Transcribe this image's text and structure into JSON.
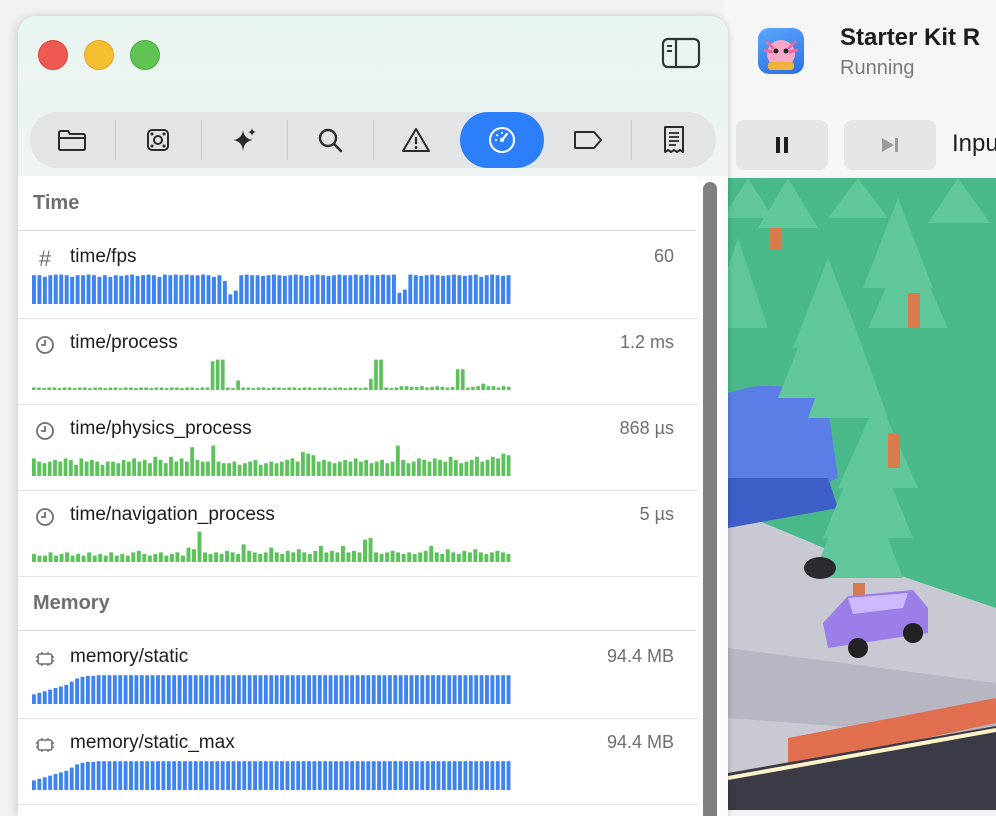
{
  "window": {
    "traffic_lights": [
      "close",
      "minimize",
      "zoom"
    ],
    "toolbar_icons": [
      "folder-icon",
      "scene-icon",
      "sparkles-icon",
      "search-icon",
      "warning-icon",
      "gauge-icon",
      "tag-icon",
      "receipt-icon"
    ],
    "active_tab": "gauge-icon"
  },
  "app": {
    "title": "Starter Kit R",
    "status": "Running",
    "input_label": "Inpu"
  },
  "colors": {
    "accent": "#2d7ff9",
    "bar_blue": "#3d84ef",
    "bar_green": "#5cc35a"
  },
  "sections": [
    {
      "title": "Time",
      "rows": [
        {
          "icon": "hash-icon",
          "icon_glyph": "#",
          "name": "time/fps",
          "value": "60",
          "color": "blue",
          "levels": [
            0.9,
            0.9,
            0.85,
            0.9,
            0.92,
            0.92,
            0.9,
            0.85,
            0.9,
            0.9,
            0.92,
            0.9,
            0.85,
            0.9,
            0.85,
            0.9,
            0.88,
            0.9,
            0.92,
            0.88,
            0.9,
            0.92,
            0.9,
            0.85,
            0.92,
            0.9,
            0.92,
            0.9,
            0.92,
            0.9,
            0.9,
            0.92,
            0.9,
            0.85,
            0.9,
            0.72,
            0.3,
            0.42,
            0.9,
            0.92,
            0.9,
            0.9,
            0.88,
            0.9,
            0.92,
            0.9,
            0.88,
            0.9,
            0.92,
            0.9,
            0.88,
            0.9,
            0.92,
            0.9,
            0.88,
            0.9,
            0.92,
            0.9,
            0.9,
            0.92,
            0.9,
            0.92,
            0.9,
            0.9,
            0.92,
            0.9,
            0.92,
            0.35,
            0.45,
            0.92,
            0.9,
            0.88,
            0.9,
            0.92,
            0.9,
            0.88,
            0.9,
            0.92,
            0.9,
            0.88,
            0.9,
            0.92,
            0.85,
            0.9,
            0.92,
            0.9,
            0.88,
            0.9
          ]
        },
        {
          "icon": "clock-icon",
          "name": "time/process",
          "value": "1.2 ms",
          "color": "green",
          "levels": [
            0.08,
            0.08,
            0.06,
            0.08,
            0.08,
            0.06,
            0.08,
            0.08,
            0.06,
            0.08,
            0.08,
            0.06,
            0.08,
            0.08,
            0.06,
            0.08,
            0.08,
            0.06,
            0.08,
            0.08,
            0.06,
            0.08,
            0.08,
            0.06,
            0.08,
            0.08,
            0.06,
            0.08,
            0.08,
            0.06,
            0.08,
            0.08,
            0.06,
            0.08,
            0.08,
            0.9,
            0.95,
            0.95,
            0.08,
            0.06,
            0.3,
            0.08,
            0.08,
            0.06,
            0.08,
            0.08,
            0.06,
            0.08,
            0.08,
            0.06,
            0.08,
            0.08,
            0.06,
            0.08,
            0.08,
            0.06,
            0.08,
            0.08,
            0.06,
            0.08,
            0.08,
            0.06,
            0.08,
            0.08,
            0.06,
            0.08,
            0.35,
            0.95,
            0.95,
            0.08,
            0.06,
            0.08,
            0.12,
            0.12,
            0.1,
            0.1,
            0.12,
            0.08,
            0.1,
            0.12,
            0.1,
            0.08,
            0.1,
            0.65,
            0.65,
            0.08,
            0.1,
            0.12,
            0.2,
            0.12,
            0.12,
            0.08,
            0.12,
            0.1
          ]
        },
        {
          "icon": "clock-icon",
          "name": "time/physics_process",
          "value": "868 µs",
          "color": "green",
          "levels": [
            0.55,
            0.45,
            0.4,
            0.45,
            0.5,
            0.45,
            0.55,
            0.5,
            0.35,
            0.55,
            0.45,
            0.5,
            0.45,
            0.35,
            0.45,
            0.45,
            0.4,
            0.5,
            0.45,
            0.55,
            0.45,
            0.5,
            0.4,
            0.6,
            0.5,
            0.4,
            0.6,
            0.45,
            0.55,
            0.45,
            0.9,
            0.5,
            0.45,
            0.45,
            0.95,
            0.45,
            0.4,
            0.4,
            0.45,
            0.35,
            0.4,
            0.45,
            0.5,
            0.35,
            0.4,
            0.45,
            0.4,
            0.45,
            0.5,
            0.55,
            0.45,
            0.75,
            0.7,
            0.65,
            0.45,
            0.5,
            0.45,
            0.4,
            0.45,
            0.5,
            0.45,
            0.55,
            0.45,
            0.5,
            0.4,
            0.45,
            0.5,
            0.4,
            0.45,
            0.95,
            0.5,
            0.4,
            0.45,
            0.55,
            0.5,
            0.45,
            0.55,
            0.5,
            0.45,
            0.6,
            0.5,
            0.4,
            0.45,
            0.5,
            0.6,
            0.45,
            0.5,
            0.6,
            0.55,
            0.7,
            0.65
          ]
        },
        {
          "icon": "clock-icon",
          "name": "time/navigation_process",
          "value": "5 µs",
          "color": "green",
          "levels": [
            0.25,
            0.2,
            0.2,
            0.3,
            0.2,
            0.25,
            0.3,
            0.2,
            0.25,
            0.2,
            0.3,
            0.2,
            0.25,
            0.2,
            0.3,
            0.2,
            0.25,
            0.2,
            0.3,
            0.35,
            0.25,
            0.2,
            0.25,
            0.3,
            0.2,
            0.25,
            0.3,
            0.2,
            0.45,
            0.4,
            0.95,
            0.3,
            0.25,
            0.3,
            0.25,
            0.35,
            0.3,
            0.25,
            0.55,
            0.35,
            0.3,
            0.25,
            0.3,
            0.45,
            0.3,
            0.25,
            0.35,
            0.3,
            0.4,
            0.3,
            0.25,
            0.35,
            0.5,
            0.3,
            0.35,
            0.3,
            0.5,
            0.3,
            0.35,
            0.3,
            0.7,
            0.75,
            0.3,
            0.25,
            0.3,
            0.35,
            0.3,
            0.25,
            0.3,
            0.25,
            0.3,
            0.35,
            0.5,
            0.3,
            0.25,
            0.4,
            0.3,
            0.25,
            0.35,
            0.3,
            0.4,
            0.3,
            0.25,
            0.3,
            0.35,
            0.3,
            0.25
          ]
        }
      ]
    },
    {
      "title": "Memory",
      "rows": [
        {
          "icon": "chip-icon",
          "name": "memory/static",
          "value": "94.4 MB",
          "color": "blue",
          "levels": [
            0.3,
            0.35,
            0.4,
            0.45,
            0.5,
            0.55,
            0.6,
            0.7,
            0.8,
            0.85,
            0.88,
            0.88,
            0.9,
            0.9,
            0.9,
            0.9,
            0.9,
            0.9,
            0.9,
            0.9,
            0.9,
            0.9,
            0.9,
            0.9,
            0.9,
            0.9,
            0.9,
            0.9,
            0.9,
            0.9,
            0.9,
            0.9,
            0.9,
            0.9,
            0.9,
            0.9,
            0.9,
            0.9,
            0.9,
            0.9,
            0.9,
            0.9,
            0.9,
            0.9,
            0.9,
            0.9,
            0.9,
            0.9,
            0.9,
            0.9,
            0.9,
            0.9,
            0.9,
            0.9,
            0.9,
            0.9,
            0.9,
            0.9,
            0.9,
            0.9,
            0.9,
            0.9,
            0.9,
            0.9,
            0.9,
            0.9,
            0.9,
            0.9,
            0.9,
            0.9,
            0.9,
            0.9,
            0.9,
            0.9,
            0.9,
            0.9,
            0.9,
            0.9,
            0.9,
            0.9,
            0.9,
            0.9,
            0.9,
            0.9,
            0.9,
            0.9,
            0.9,
            0.9,
            0.9
          ]
        },
        {
          "icon": "chip-icon",
          "name": "memory/static_max",
          "value": "94.4 MB",
          "color": "blue",
          "levels": [
            0.3,
            0.35,
            0.4,
            0.45,
            0.5,
            0.55,
            0.6,
            0.7,
            0.8,
            0.85,
            0.88,
            0.88,
            0.9,
            0.9,
            0.9,
            0.9,
            0.9,
            0.9,
            0.9,
            0.9,
            0.9,
            0.9,
            0.9,
            0.9,
            0.9,
            0.9,
            0.9,
            0.9,
            0.9,
            0.9,
            0.9,
            0.9,
            0.9,
            0.9,
            0.9,
            0.9,
            0.9,
            0.9,
            0.9,
            0.9,
            0.9,
            0.9,
            0.9,
            0.9,
            0.9,
            0.9,
            0.9,
            0.9,
            0.9,
            0.9,
            0.9,
            0.9,
            0.9,
            0.9,
            0.9,
            0.9,
            0.9,
            0.9,
            0.9,
            0.9,
            0.9,
            0.9,
            0.9,
            0.9,
            0.9,
            0.9,
            0.9,
            0.9,
            0.9,
            0.9,
            0.9,
            0.9,
            0.9,
            0.9,
            0.9,
            0.9,
            0.9,
            0.9,
            0.9,
            0.9,
            0.9,
            0.9,
            0.9,
            0.9,
            0.9,
            0.9,
            0.9,
            0.9,
            0.9
          ]
        }
      ]
    }
  ]
}
